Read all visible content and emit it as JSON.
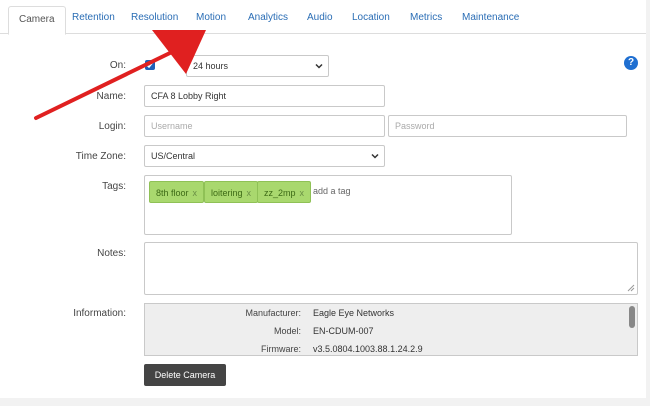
{
  "tabs": [
    {
      "label": "Camera",
      "active": true
    },
    {
      "label": "Retention"
    },
    {
      "label": "Resolution"
    },
    {
      "label": "Motion"
    },
    {
      "label": "Analytics"
    },
    {
      "label": "Audio"
    },
    {
      "label": "Location"
    },
    {
      "label": "Metrics"
    },
    {
      "label": "Maintenance"
    }
  ],
  "form": {
    "on_label": "On:",
    "on_checked": true,
    "schedule_value": "24 hours",
    "name_label": "Name:",
    "name_value": "CFA 8 Lobby Right",
    "login_label": "Login:",
    "username_placeholder": "Username",
    "password_placeholder": "Password",
    "timezone_label": "Time Zone:",
    "timezone_value": "US/Central",
    "tags_label": "Tags:",
    "tags": [
      "8th floor",
      "loitering",
      "zz_2mp"
    ],
    "tag_remove": "x",
    "add_tag_placeholder": "add a tag",
    "notes_label": "Notes:",
    "notes_value": "",
    "information_label": "Information:",
    "information": [
      {
        "key": "Manufacturer:",
        "value": "Eagle Eye Networks"
      },
      {
        "key": "Model:",
        "value": "EN-CDUM-007"
      },
      {
        "key": "Firmware:",
        "value": "v3.5.0804.1003.88.1.24.2.9"
      }
    ],
    "delete_button": "Delete Camera",
    "help_glyph": "?"
  },
  "icons": {
    "help": "question-circle-icon",
    "select_caret": "chevron-down-icon",
    "annotation": "red-arrow"
  },
  "colors": {
    "tab_link": "#2a6db5",
    "tag_bg": "#a9d86e",
    "button_bg": "#444444",
    "help_bg": "#1f6fd1",
    "annotation_arrow": "#e02020"
  }
}
